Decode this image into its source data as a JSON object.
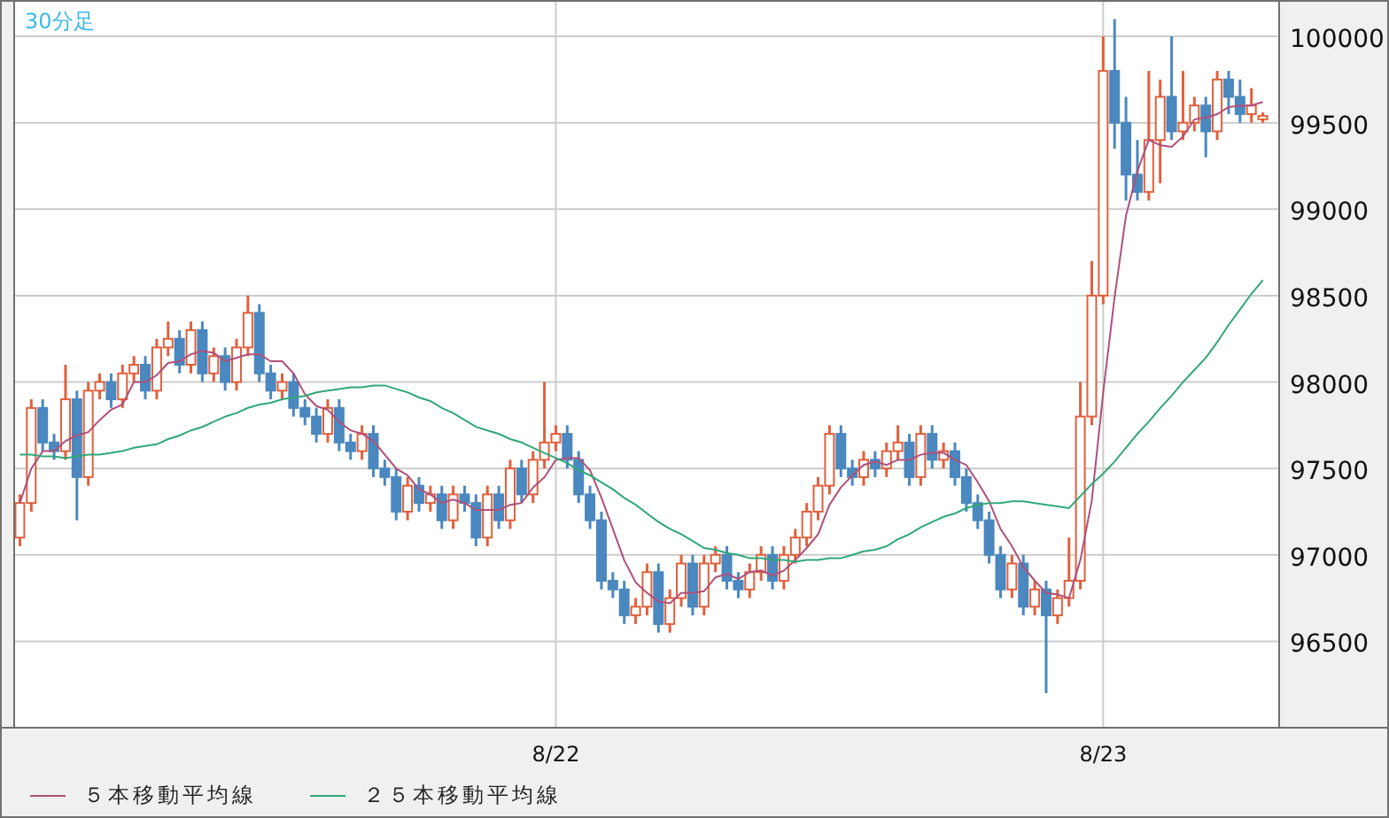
{
  "chart": {
    "timeframe_label": "30分足",
    "chart_data": {
      "type": "candlestick",
      "categories": [
        null,
        null,
        null,
        null,
        null,
        null,
        null,
        null,
        null,
        null,
        null,
        null,
        null,
        null,
        null,
        null,
        null,
        null,
        null,
        null,
        null,
        null,
        null,
        null,
        null,
        null,
        null,
        null,
        null,
        null,
        null,
        null,
        null,
        null,
        null,
        null,
        null,
        null,
        null,
        null,
        null,
        null,
        null,
        null,
        null,
        null,
        null,
        "8/22",
        null,
        null,
        null,
        null,
        null,
        null,
        null,
        null,
        null,
        null,
        null,
        null,
        null,
        null,
        null,
        null,
        null,
        null,
        null,
        null,
        null,
        null,
        null,
        null,
        null,
        null,
        null,
        null,
        null,
        null,
        null,
        null,
        null,
        null,
        null,
        null,
        null,
        null,
        null,
        null,
        null,
        null,
        null,
        null,
        null,
        null,
        null,
        "8/23",
        null,
        null,
        null,
        null,
        null,
        null,
        null,
        null,
        null,
        null,
        null,
        null,
        null,
        null
      ],
      "yticks": [
        96500,
        97000,
        97500,
        98000,
        98500,
        99000,
        99500,
        100000
      ],
      "ylim": [
        96000,
        100200
      ],
      "grid": true,
      "ohlc": [
        [
          97100,
          97350,
          97050,
          97300
        ],
        [
          97300,
          97900,
          97250,
          97850
        ],
        [
          97850,
          97900,
          97600,
          97650
        ],
        [
          97650,
          97700,
          97550,
          97600
        ],
        [
          97600,
          98100,
          97550,
          97900
        ],
        [
          97900,
          97950,
          97200,
          97450
        ],
        [
          97450,
          98000,
          97400,
          97950
        ],
        [
          97950,
          98050,
          97900,
          98000
        ],
        [
          98000,
          98050,
          97850,
          97900
        ],
        [
          97900,
          98100,
          97850,
          98050
        ],
        [
          98050,
          98150,
          98000,
          98100
        ],
        [
          98100,
          98150,
          97900,
          97950
        ],
        [
          97950,
          98250,
          97900,
          98200
        ],
        [
          98200,
          98350,
          98150,
          98250
        ],
        [
          98250,
          98300,
          98050,
          98100
        ],
        [
          98100,
          98350,
          98050,
          98300
        ],
        [
          98300,
          98350,
          98000,
          98050
        ],
        [
          98050,
          98200,
          98000,
          98150
        ],
        [
          98150,
          98200,
          97950,
          98000
        ],
        [
          98000,
          98250,
          97950,
          98200
        ],
        [
          98200,
          98500,
          98150,
          98400
        ],
        [
          98400,
          98450,
          98000,
          98050
        ],
        [
          98050,
          98100,
          97900,
          97950
        ],
        [
          97950,
          98050,
          97900,
          98000
        ],
        [
          98000,
          98050,
          97800,
          97850
        ],
        [
          97850,
          97900,
          97750,
          97800
        ],
        [
          97800,
          97850,
          97650,
          97700
        ],
        [
          97700,
          97900,
          97650,
          97850
        ],
        [
          97850,
          97900,
          97600,
          97650
        ],
        [
          97650,
          97700,
          97550,
          97600
        ],
        [
          97600,
          97750,
          97550,
          97700
        ],
        [
          97700,
          97750,
          97450,
          97500
        ],
        [
          97500,
          97550,
          97400,
          97450
        ],
        [
          97450,
          97500,
          97200,
          97250
        ],
        [
          97250,
          97450,
          97200,
          97400
        ],
        [
          97400,
          97450,
          97250,
          97300
        ],
        [
          97300,
          97400,
          97250,
          97350
        ],
        [
          97350,
          97400,
          97150,
          97200
        ],
        [
          97200,
          97400,
          97150,
          97350
        ],
        [
          97350,
          97400,
          97250,
          97300
        ],
        [
          97300,
          97350,
          97050,
          97100
        ],
        [
          97100,
          97400,
          97050,
          97350
        ],
        [
          97350,
          97400,
          97150,
          97200
        ],
        [
          97200,
          97550,
          97150,
          97500
        ],
        [
          97500,
          97550,
          97300,
          97350
        ],
        [
          97350,
          97600,
          97300,
          97550
        ],
        [
          97550,
          98000,
          97500,
          97650
        ],
        [
          97650,
          97750,
          97600,
          97700
        ],
        [
          97700,
          97750,
          97500,
          97550
        ],
        [
          97550,
          97600,
          97300,
          97350
        ],
        [
          97350,
          97400,
          97150,
          97200
        ],
        [
          97200,
          97250,
          96800,
          96850
        ],
        [
          96850,
          96900,
          96750,
          96800
        ],
        [
          96800,
          96850,
          96600,
          96650
        ],
        [
          96650,
          96750,
          96600,
          96700
        ],
        [
          96700,
          96950,
          96650,
          96900
        ],
        [
          96900,
          96950,
          96550,
          96600
        ],
        [
          96600,
          96800,
          96550,
          96750
        ],
        [
          96750,
          97000,
          96700,
          96950
        ],
        [
          96950,
          97000,
          96650,
          96700
        ],
        [
          96700,
          97000,
          96650,
          96950
        ],
        [
          96950,
          97050,
          96900,
          97000
        ],
        [
          97000,
          97050,
          96800,
          96850
        ],
        [
          96850,
          96900,
          96750,
          96800
        ],
        [
          96800,
          96950,
          96750,
          96900
        ],
        [
          96900,
          97050,
          96850,
          97000
        ],
        [
          97000,
          97050,
          96800,
          96850
        ],
        [
          96850,
          97050,
          96800,
          97000
        ],
        [
          97000,
          97150,
          96950,
          97100
        ],
        [
          97100,
          97300,
          97050,
          97250
        ],
        [
          97250,
          97450,
          97200,
          97400
        ],
        [
          97400,
          97750,
          97350,
          97700
        ],
        [
          97700,
          97750,
          97450,
          97500
        ],
        [
          97500,
          97550,
          97400,
          97450
        ],
        [
          97450,
          97600,
          97400,
          97550
        ],
        [
          97550,
          97600,
          97450,
          97500
        ],
        [
          97500,
          97650,
          97450,
          97600
        ],
        [
          97600,
          97750,
          97550,
          97650
        ],
        [
          97650,
          97700,
          97400,
          97450
        ],
        [
          97450,
          97750,
          97400,
          97700
        ],
        [
          97700,
          97750,
          97500,
          97550
        ],
        [
          97550,
          97650,
          97500,
          97600
        ],
        [
          97600,
          97650,
          97400,
          97450
        ],
        [
          97450,
          97500,
          97250,
          97300
        ],
        [
          97300,
          97350,
          97150,
          97200
        ],
        [
          97200,
          97250,
          96950,
          97000
        ],
        [
          97000,
          97050,
          96750,
          96800
        ],
        [
          96800,
          97000,
          96750,
          96950
        ],
        [
          96950,
          97000,
          96650,
          96700
        ],
        [
          96700,
          96850,
          96650,
          96800
        ],
        [
          96800,
          96850,
          96200,
          96650
        ],
        [
          96650,
          96800,
          96600,
          96750
        ],
        [
          96750,
          97100,
          96700,
          96850
        ],
        [
          96850,
          98000,
          96800,
          97800
        ],
        [
          97800,
          98700,
          97750,
          98500
        ],
        [
          98500,
          100000,
          98450,
          99800
        ],
        [
          99800,
          100100,
          99350,
          99500
        ],
        [
          99500,
          99650,
          99050,
          99200
        ],
        [
          99200,
          99400,
          99050,
          99100
        ],
        [
          99100,
          99800,
          99050,
          99400
        ],
        [
          99400,
          99750,
          99150,
          99650
        ],
        [
          99650,
          100000,
          99400,
          99450
        ],
        [
          99450,
          99800,
          99400,
          99500
        ],
        [
          99500,
          99650,
          99450,
          99600
        ],
        [
          99600,
          99650,
          99300,
          99450
        ],
        [
          99450,
          99800,
          99400,
          99750
        ],
        [
          99750,
          99800,
          99550,
          99650
        ],
        [
          99650,
          99750,
          99500,
          99550
        ],
        [
          99550,
          99700,
          99500,
          99600
        ],
        [
          99520,
          99560,
          99500,
          99540
        ]
      ],
      "series": [
        {
          "name": "５本移動平均線",
          "type": "line",
          "color": "#b0507a",
          "values": [
            97300,
            97500,
            97600,
            97600,
            97660,
            97690,
            97710,
            97780,
            97840,
            97870,
            98000,
            98000,
            98040,
            98110,
            98120,
            98160,
            98180,
            98170,
            98120,
            98140,
            98160,
            98160,
            98120,
            98120,
            98050,
            97930,
            97860,
            97840,
            97770,
            97720,
            97700,
            97660,
            97580,
            97500,
            97460,
            97380,
            97350,
            97300,
            97320,
            97300,
            97260,
            97260,
            97260,
            97290,
            97300,
            97390,
            97450,
            97550,
            97560,
            97560,
            97490,
            97330,
            97150,
            96970,
            96840,
            96780,
            96730,
            96720,
            96780,
            96780,
            96790,
            96870,
            96890,
            96860,
            96900,
            96910,
            96880,
            96910,
            96970,
            97040,
            97120,
            97290,
            97390,
            97460,
            97520,
            97540,
            97520,
            97550,
            97550,
            97580,
            97590,
            97590,
            97550,
            97520,
            97420,
            97310,
            97150,
            97050,
            96930,
            96850,
            96780,
            96770,
            96750,
            96970,
            97310,
            97940,
            98490,
            98960,
            99220,
            99400,
            99370,
            99360,
            99420,
            99520,
            99530,
            99550,
            99590,
            99600,
            99600,
            99620
          ]
        },
        {
          "name": "２５本移動平均線",
          "type": "line",
          "color": "#30a878",
          "values": [
            97580,
            97580,
            97570,
            97570,
            97560,
            97570,
            97580,
            97580,
            97590,
            97600,
            97620,
            97630,
            97640,
            97670,
            97690,
            97720,
            97740,
            97770,
            97800,
            97820,
            97850,
            97870,
            97880,
            97900,
            97910,
            97920,
            97940,
            97950,
            97960,
            97970,
            97970,
            97980,
            97980,
            97960,
            97940,
            97910,
            97890,
            97850,
            97820,
            97780,
            97740,
            97720,
            97700,
            97670,
            97650,
            97620,
            97590,
            97560,
            97530,
            97490,
            97460,
            97420,
            97380,
            97330,
            97290,
            97240,
            97190,
            97150,
            97120,
            97080,
            97040,
            97030,
            97010,
            97000,
            96980,
            96980,
            96970,
            96970,
            96960,
            96970,
            96970,
            96980,
            96980,
            97000,
            97020,
            97030,
            97050,
            97090,
            97120,
            97160,
            97190,
            97220,
            97240,
            97270,
            97290,
            97300,
            97300,
            97310,
            97310,
            97300,
            97290,
            97280,
            97270,
            97340,
            97410,
            97470,
            97540,
            97620,
            97700,
            97770,
            97850,
            97920,
            98000,
            98070,
            98140,
            98230,
            98330,
            98420,
            98510,
            98590
          ]
        }
      ]
    }
  }
}
